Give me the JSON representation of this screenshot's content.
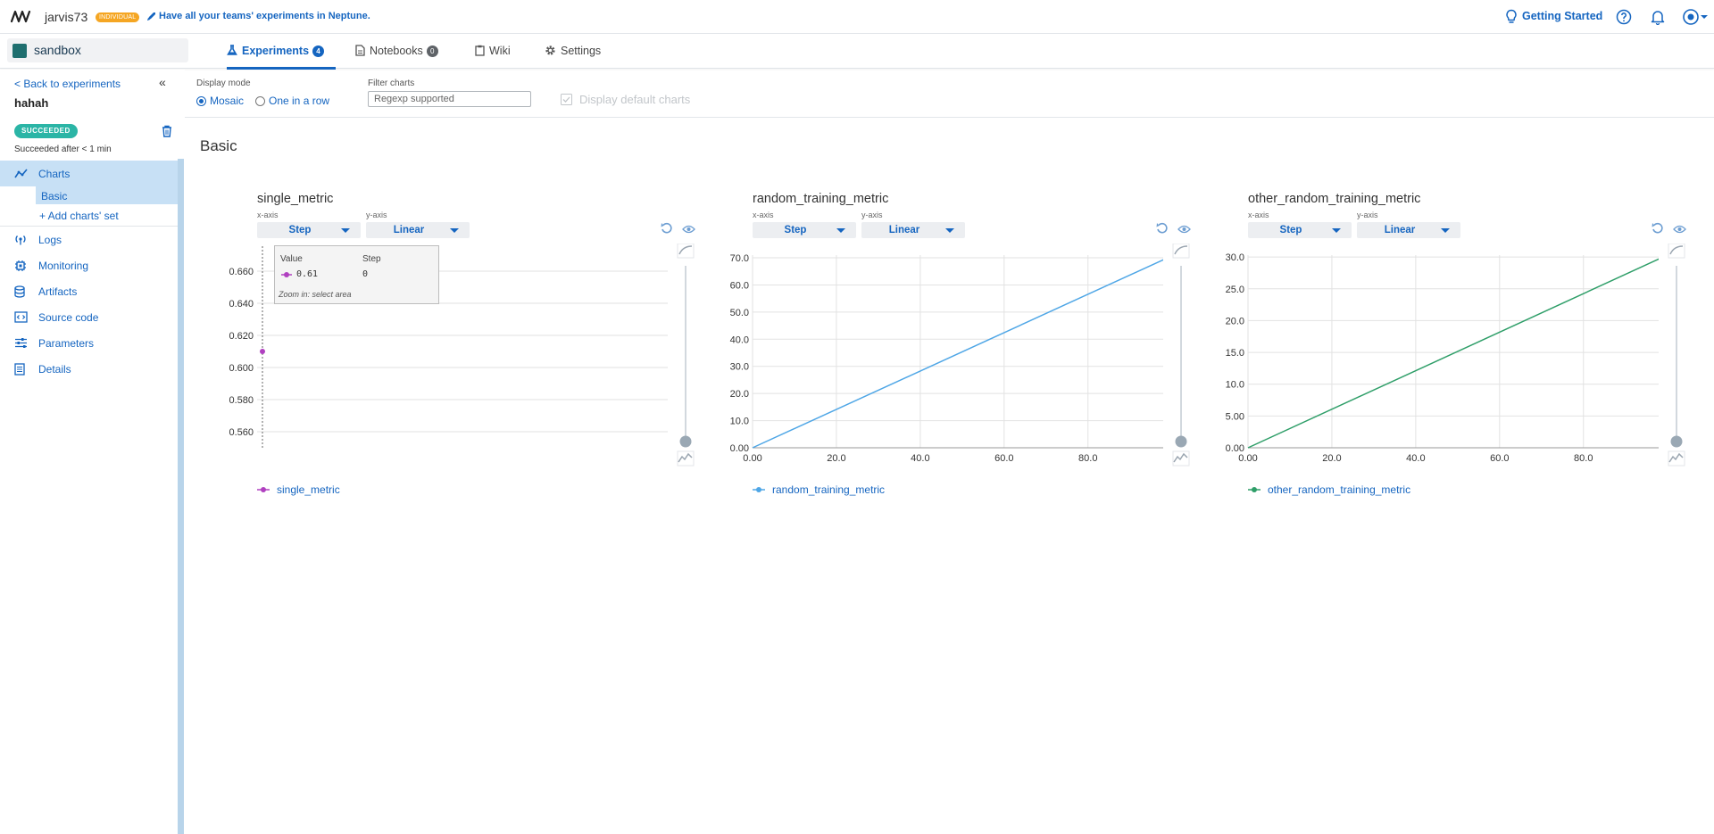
{
  "topbar": {
    "username": "jarvis73",
    "plan_badge": "INDIVIDUAL",
    "promo_text": "Have all your teams' experiments in Neptune.",
    "getting_started": "Getting Started"
  },
  "project": {
    "name": "sandbox",
    "tabs": [
      {
        "label": "Experiments",
        "count": "4"
      },
      {
        "label": "Notebooks",
        "count": "0"
      },
      {
        "label": "Wiki"
      },
      {
        "label": "Settings"
      }
    ]
  },
  "sidebar": {
    "back_label": "< Back to experiments",
    "experiment_name": "hahah",
    "status": "SUCCEEDED",
    "duration": "Succeeded after < 1 min",
    "charts_label": "Charts",
    "basic_label": "Basic",
    "add_set_label": "+ Add charts' set",
    "items": [
      {
        "label": "Logs",
        "icon": "logs-icon"
      },
      {
        "label": "Monitoring",
        "icon": "monitoring-icon"
      },
      {
        "label": "Artifacts",
        "icon": "database-icon"
      },
      {
        "label": "Source code",
        "icon": "source-code-icon"
      },
      {
        "label": "Parameters",
        "icon": "sliders-icon"
      },
      {
        "label": "Details",
        "icon": "details-icon"
      }
    ]
  },
  "controls": {
    "display_mode_label": "Display mode",
    "mosaic": "Mosaic",
    "one_in_a_row": "One in a row",
    "filter_label": "Filter charts",
    "filter_placeholder": "Regexp supported",
    "default_charts": "Display default charts"
  },
  "section_title": "Basic",
  "axis_labels": {
    "x": "x-axis",
    "y": "y-axis",
    "x_value": "Step",
    "y_value": "Linear"
  },
  "tooltip": {
    "value_header": "Value",
    "step_header": "Step",
    "value": "0.61",
    "step": "0",
    "hint": "Zoom in: select area"
  },
  "chart_data": [
    {
      "type": "scatter",
      "title": "single_metric",
      "color": "#b040c0",
      "x": [
        0
      ],
      "y": [
        0.61
      ],
      "ylim": [
        0.55,
        0.67
      ],
      "yticks": [
        "0.560",
        "0.580",
        "0.600",
        "0.620",
        "0.640",
        "0.660"
      ],
      "legend": "single_metric"
    },
    {
      "type": "line",
      "title": "random_training_metric",
      "color": "#4ea6e6",
      "x": [
        0,
        99
      ],
      "y": [
        0,
        70
      ],
      "xlim": [
        0,
        99
      ],
      "ylim": [
        0,
        71
      ],
      "yticks": [
        "0.00",
        "10.0",
        "20.0",
        "30.0",
        "40.0",
        "50.0",
        "60.0",
        "70.0"
      ],
      "xticks": [
        "0.00",
        "20.0",
        "40.0",
        "60.0",
        "80.0"
      ],
      "legend": "random_training_metric"
    },
    {
      "type": "line",
      "title": "other_random_training_metric",
      "color": "#2e9e68",
      "x": [
        0,
        99
      ],
      "y": [
        0,
        30
      ],
      "xlim": [
        0,
        99
      ],
      "ylim": [
        0,
        30.3
      ],
      "yticks": [
        "0.00",
        "5.00",
        "10.0",
        "15.0",
        "20.0",
        "25.0",
        "30.0"
      ],
      "xticks": [
        "0.00",
        "20.0",
        "40.0",
        "60.0",
        "80.0"
      ],
      "legend": "other_random_training_metric"
    }
  ]
}
